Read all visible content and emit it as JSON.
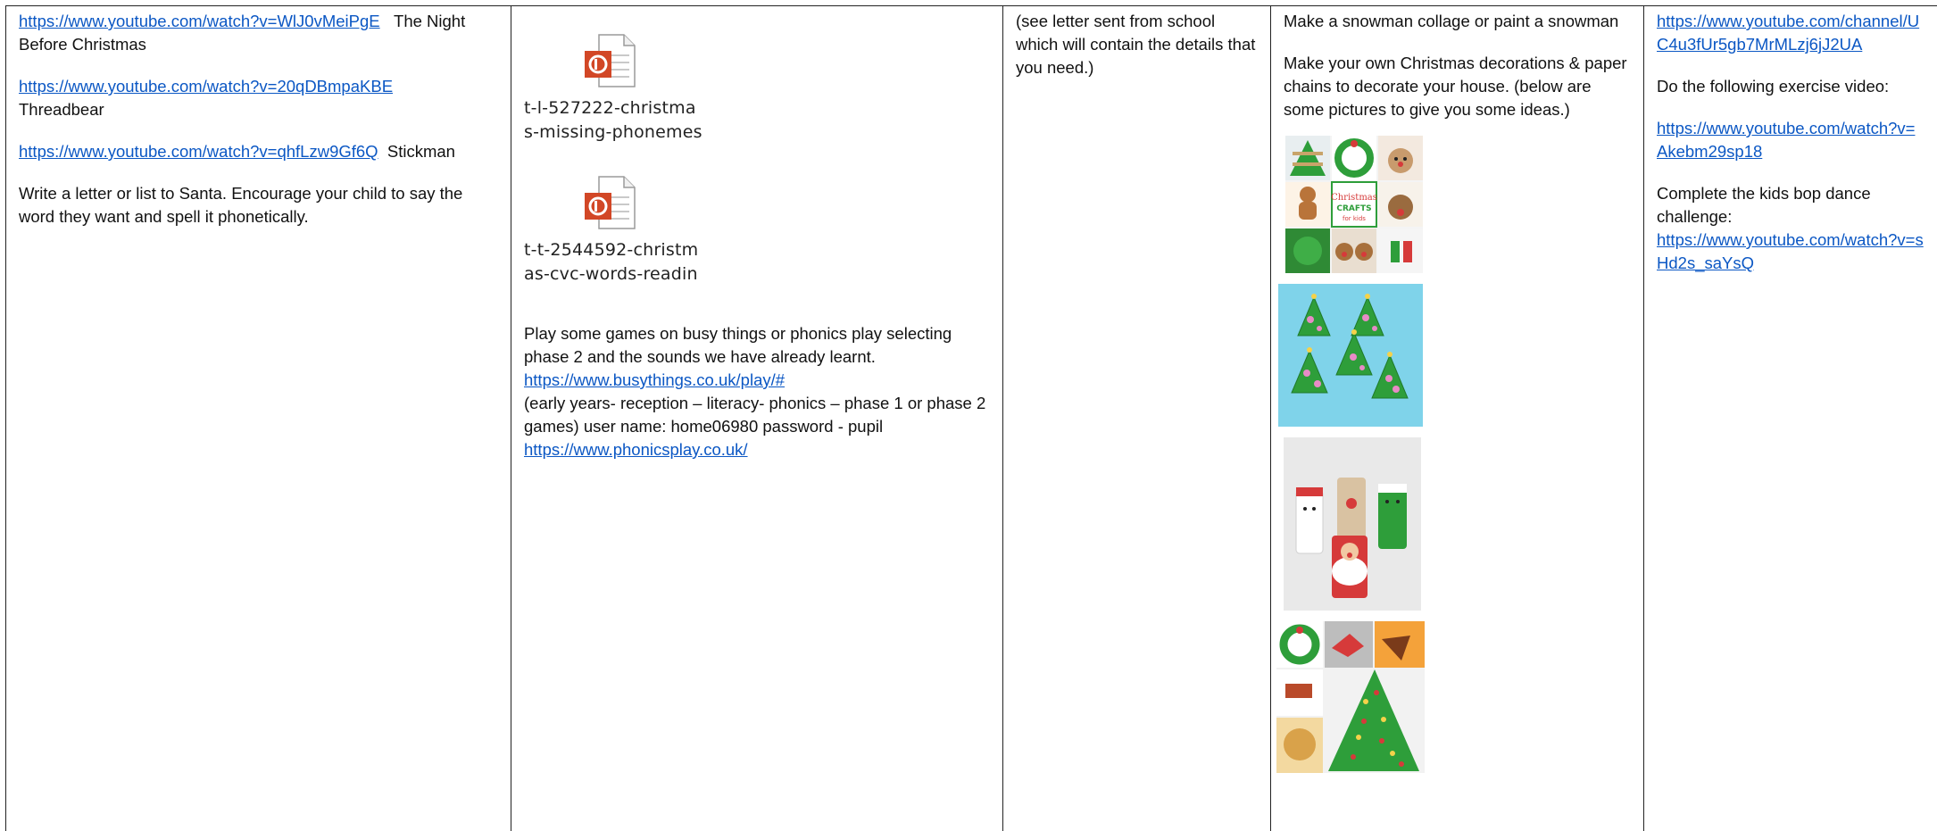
{
  "col1": {
    "l1_url": "https://www.youtube.com/watch?v=WlJ0vMeiPgE",
    "l1_text": "The Night Before Christmas",
    "l2_url": "https://www.youtube.com/watch?v=20qDBmpaKBE",
    "l2_text": "Threadbear",
    "l3_url": "https://www.youtube.com/watch?v=qhfLzw9Gf6Q",
    "l3_text": "Stickman",
    "task": "Write a letter or list to Santa. Encourage your child to say the word they want and spell it phonetically."
  },
  "col2": {
    "file1_a": "t-l-527222-christma",
    "file1_b": "s-missing-phonemes",
    "file2_a": "t-t-2544592-christm",
    "file2_b": "as-cvc-words-readin",
    "games_text": "Play some games on busy things or phonics play selecting phase 2 and the sounds we have already learnt.",
    "busy_url": "https://www.busythings.co.uk/play/#",
    "games_note": "(early years- reception – literacy- phonics – phase 1 or phase 2 games) user name: home06980 password - pupil",
    "phonics_url": "https://www.phonicsplay.co.uk/"
  },
  "col3": {
    "note": "(see letter sent from school which will contain the details that you need.)"
  },
  "col4": {
    "task1": "Make a snowman collage or paint a snowman",
    "task2": "Make your own Christmas decorations & paper chains to decorate your house. (below are some pictures to give you some ideas.)",
    "collage_caption_1": "Christmas",
    "collage_caption_2": "CRAFTS",
    "collage_caption_3": "for kids"
  },
  "col5": {
    "channel_url": "https://www.youtube.com/channel/UC4u3fUr5gb7MrMLzj6jJ2UA",
    "exercise_text": "Do the following exercise video:",
    "exercise_url": "https://www.youtube.com/watch?v=Akebm29sp18",
    "bop_text": "Complete the kids bop dance challenge:",
    "bop_url": "https://www.youtube.com/watch?v=sHd2s_saYsQ"
  },
  "colors": {
    "link": "#0b57c4",
    "ppt_orange": "#d24726",
    "sky_blue": "#7fd3ea",
    "tree_green": "#2e9e3a"
  }
}
